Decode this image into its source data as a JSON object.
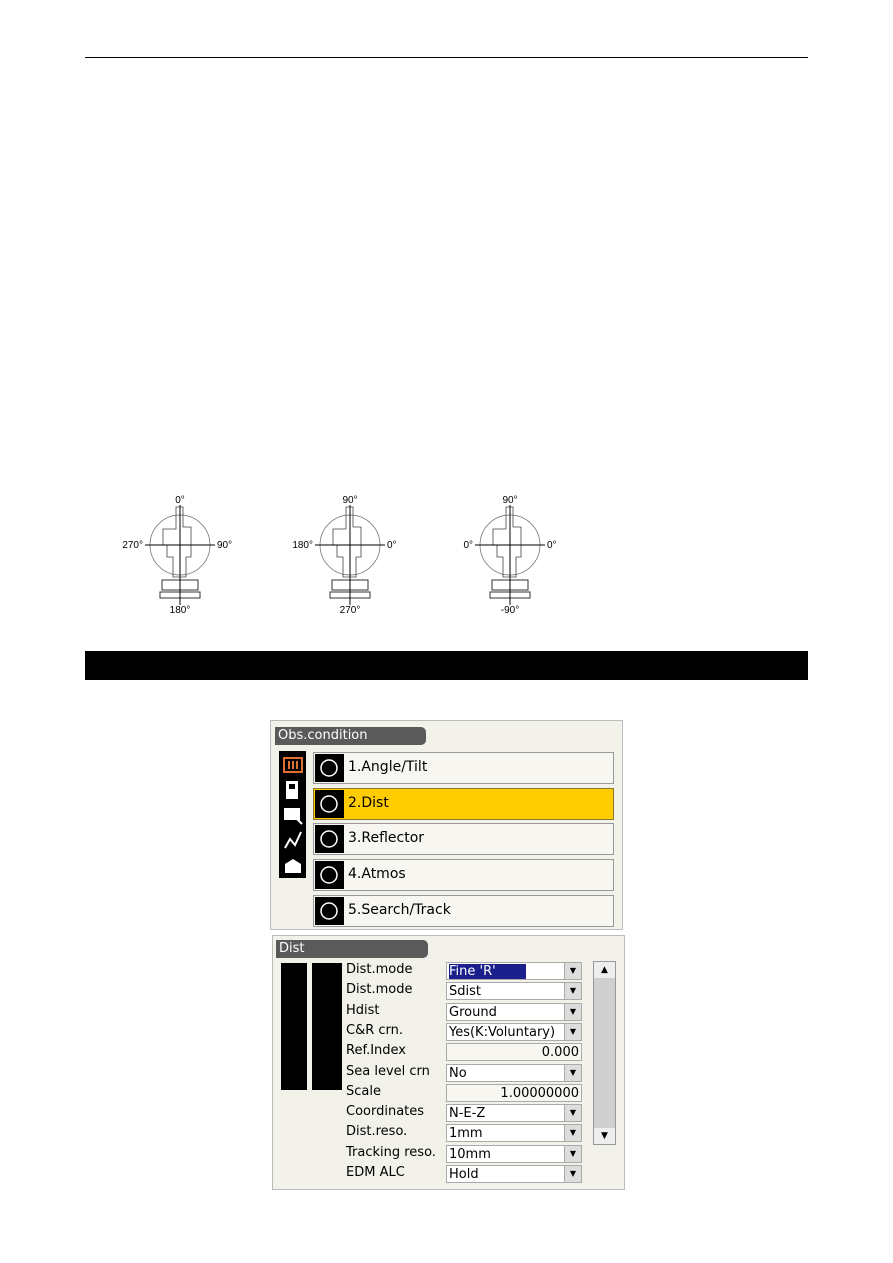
{
  "diagrams": [
    {
      "top": "0°",
      "left": "270°",
      "right": "90°",
      "bottom": "180°"
    },
    {
      "top": "90°",
      "left": "180°",
      "right": "0°",
      "bottom": "270°"
    },
    {
      "top": "90°",
      "left": "0°",
      "right": "0°",
      "bottom": "-90°"
    }
  ],
  "menu": {
    "title": "Obs.condition",
    "items": [
      {
        "label": "1.Angle/Tilt",
        "icon": "angle-tilt-icon"
      },
      {
        "label": "2.Dist",
        "icon": "ruler-icon",
        "selected": true
      },
      {
        "label": "3.Reflector",
        "icon": "reflector-icon"
      },
      {
        "label": "4.Atmos",
        "icon": "weather-icon"
      },
      {
        "label": "5.Search/Track",
        "icon": "search-track-icon"
      }
    ]
  },
  "dist": {
    "title": "Dist",
    "rows": [
      {
        "label": "Dist.mode",
        "value": "Fine 'R'",
        "type": "select",
        "highlight": true
      },
      {
        "label": "Dist.mode",
        "value": "Sdist",
        "type": "select"
      },
      {
        "label": "Hdist",
        "value": "Ground",
        "type": "select"
      },
      {
        "label": "C&R crn.",
        "value": "Yes(K:Voluntary)",
        "type": "select"
      },
      {
        "label": "Ref.Index",
        "value": "0.000",
        "type": "number"
      },
      {
        "label": "Sea level crn",
        "value": "No",
        "type": "select"
      },
      {
        "label": "Scale",
        "value": "1.00000000",
        "type": "number"
      },
      {
        "label": "Coordinates",
        "value": "N-E-Z",
        "type": "select"
      },
      {
        "label": "Dist.reso.",
        "value": "1mm",
        "type": "select"
      },
      {
        "label": "Tracking reso.",
        "value": "10mm",
        "type": "select"
      },
      {
        "label": "EDM ALC",
        "value": "Hold",
        "type": "select"
      }
    ]
  },
  "colors": {
    "selected": "#ffcc00",
    "titlebar": "#5a5a5a",
    "highlight": "#1a1f8c"
  }
}
